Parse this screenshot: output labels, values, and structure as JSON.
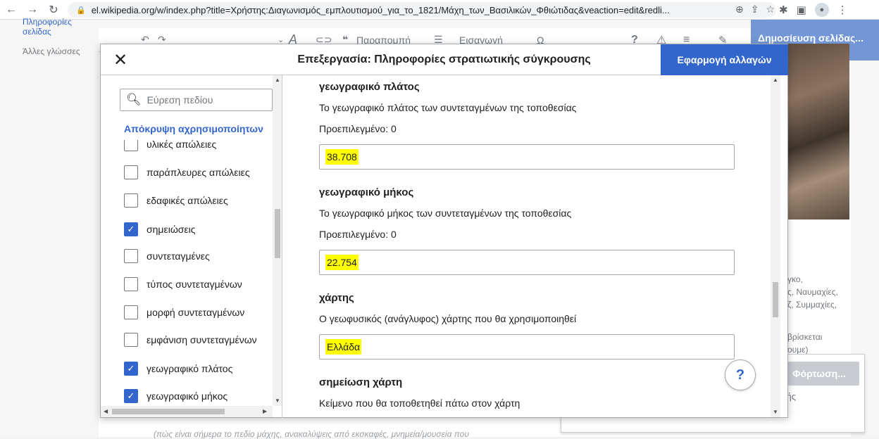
{
  "browser": {
    "url": "el.wikipedia.org/w/index.php?title=Χρήστης:Διαγωνισμός_εμπλουτισμού_για_το_1821/Μάχη_των_Βασιλικών_Φθιώτιδας&veaction=edit&redli..."
  },
  "page": {
    "left_nav_cut": "Πληροφορίες σελίδας",
    "other_languages": "Άλλες γλώσσες",
    "publish_label": "Δημοσίευση σελίδας...",
    "toolbar": {
      "cite_label": "Παραπομπή",
      "insert_label": "Εισαγωγή"
    },
    "load_label": "Φόρτωση...",
    "right_texts": [
      "γκο,",
      "ς, Ναυμαχίες,",
      "ζ, Συμμαχίες,",
      "βρίσκεται",
      "ουμε)",
      "κής"
    ],
    "bottom_text": "(πώς είναι σήμερα το πεδίο μάχης, ανακαλύψεις από εκσκαφές, μνημεία/μουσεία που"
  },
  "dialog": {
    "title": "Επεξεργασία: Πληροφορίες στρατιωτικής σύγκρουσης",
    "apply_label": "Εφαρμογή αλλαγών",
    "search_placeholder": "Εύρεση πεδίου",
    "hide_unused_label": "Απόκρυψη αχρησιμοποίητων",
    "params": [
      {
        "label": "υλικές απώλειες",
        "checked": false
      },
      {
        "label": "παράπλευρες απώλειες",
        "checked": false
      },
      {
        "label": "εδαφικές απώλειες",
        "checked": false
      },
      {
        "label": "σημειώσεις",
        "checked": true
      },
      {
        "label": "συντεταγμένες",
        "checked": false
      },
      {
        "label": "τύπος συντεταγμένων",
        "checked": false
      },
      {
        "label": "μορφή συντεταγμένων",
        "checked": false
      },
      {
        "label": "εμφάνιση συντεταγμένων",
        "checked": false
      },
      {
        "label": "γεωγραφικό πλάτος",
        "checked": true
      },
      {
        "label": "γεωγραφικό μήκος",
        "checked": true
      }
    ],
    "fields": {
      "lat": {
        "label": "γεωγραφικό πλάτος",
        "desc": "Το γεωγραφικό πλάτος των συντεταγμένων της τοποθεσίας",
        "default": "Προεπιλεγμένο: 0",
        "value": "38.708"
      },
      "lon": {
        "label": "γεωγραφικό μήκος",
        "desc": "Το γεωγραφικό μήκος των συντεταγμένων της τοποθεσίας",
        "default": "Προεπιλεγμένο: 0",
        "value": "22.754"
      },
      "map": {
        "label": "χάρτης",
        "desc": "Ο γεωφυσικός (ανάγλυφος) χάρτης που θα χρησιμοποιηθεί",
        "value": "Ελλάδα"
      },
      "map_note": {
        "label": "σημείωση χάρτη",
        "desc": "Κείμενο που θα τοποθετηθεί πάτω στον χάρτη"
      }
    },
    "help_label": "?"
  },
  "colors": {
    "accent": "#3366cc",
    "highlight": "#ffff00",
    "publish": "#7396d7"
  }
}
